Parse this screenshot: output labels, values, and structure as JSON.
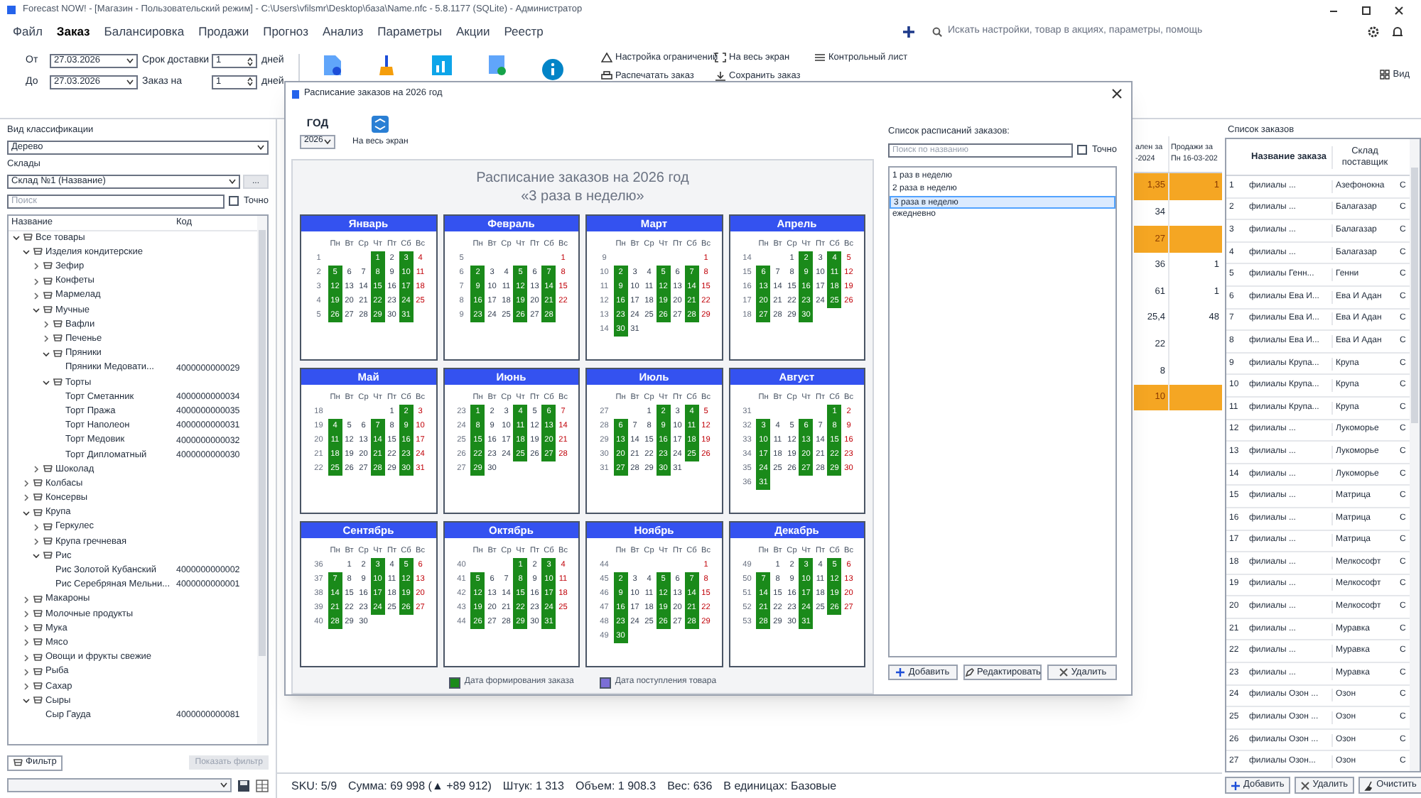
{
  "window": {
    "title": "Forecast NOW! - [Магазин - Пользовательский режим] - C:\\Users\\vfilsmr\\Desktop\\база\\Name.nfc - 5.8.1177 (SQLite) - Администратор"
  },
  "menu": [
    {
      "label": "Файл",
      "selected": false
    },
    {
      "label": "Заказ",
      "selected": true
    },
    {
      "label": "Балансировка",
      "selected": false
    },
    {
      "label": "Продажи",
      "selected": false
    },
    {
      "label": "Прогноз",
      "selected": false
    },
    {
      "label": "Анализ",
      "selected": false
    },
    {
      "label": "Параметры",
      "selected": false
    },
    {
      "label": "Акции",
      "selected": false
    },
    {
      "label": "Реестр",
      "selected": false
    }
  ],
  "search": {
    "placeholder": "Искать настройки, товар в акциях, параметры, помощь"
  },
  "toolbar": {
    "from_label": "От",
    "from": "27.03.2026",
    "to_label": "До",
    "to": "27.03.2026",
    "delivery_label": "Срок доставки",
    "delivery": "1",
    "delivery_unit": "дней",
    "order_label": "Заказ на",
    "order": "1",
    "order_unit": "дней",
    "small_buttons": [
      {
        "label": "Настройка ограничений",
        "kind": "warning"
      },
      {
        "label": "На весь экран",
        "kind": "expand"
      },
      {
        "label": "Контрольный лист",
        "kind": "list"
      },
      {
        "label": "Распечатать заказ",
        "kind": "print"
      },
      {
        "label": "Сохранить заказ",
        "kind": "save"
      }
    ],
    "view_button": "Вид"
  },
  "left": {
    "classification_label": "Вид классификации",
    "classification": "Дерево",
    "warehouse_label": "Склады",
    "warehouse": "Склад №1 (Название)",
    "more_button": "...",
    "search_placeholder": "Поиск",
    "exact": {
      "label": "Точно",
      "checked": false
    },
    "columns": [
      "Название",
      "Код"
    ],
    "tree": [
      {
        "label": "Все товары",
        "expanded": true,
        "children": [
          {
            "label": "Изделия кондитерские",
            "expanded": true,
            "children": [
              {
                "label": "Зефир",
                "expanded": false
              },
              {
                "label": "Конфеты",
                "expanded": false
              },
              {
                "label": "Мармелад",
                "expanded": false
              },
              {
                "label": "Мучные",
                "expanded": true,
                "children": [
                  {
                    "label": "Вафли",
                    "expanded": false
                  },
                  {
                    "label": "Печенье",
                    "expanded": false
                  },
                  {
                    "label": "Пряники",
                    "expanded": true,
                    "children": [
                      {
                        "label": "Пряники Медовати...",
                        "code": "4000000000029"
                      }
                    ]
                  },
                  {
                    "label": "Торты",
                    "expanded": true,
                    "children": [
                      {
                        "label": "Торт Сметанник",
                        "code": "4000000000034"
                      },
                      {
                        "label": "Торт Пража",
                        "code": "4000000000035"
                      },
                      {
                        "label": "Торт Наполеон",
                        "code": "4000000000031"
                      },
                      {
                        "label": "Торт Медовик",
                        "code": "4000000000032"
                      },
                      {
                        "label": "Торт Дипломатный",
                        "code": "4000000000030"
                      }
                    ]
                  }
                ]
              },
              {
                "label": "Шоколад",
                "expanded": false
              }
            ]
          },
          {
            "label": "Колбасы",
            "expanded": false
          },
          {
            "label": "Консервы",
            "expanded": false
          },
          {
            "label": "Крупа",
            "expanded": true,
            "children": [
              {
                "label": "Геркулес",
                "expanded": false
              },
              {
                "label": "Крупа гречневая",
                "expanded": false
              },
              {
                "label": "Рис",
                "expanded": true,
                "children": [
                  {
                    "label": "Рис Золотой Кубанский",
                    "code": "4000000000002"
                  },
                  {
                    "label": "Рис Серебряная Мельни...",
                    "code": "4000000000001"
                  }
                ]
              }
            ]
          },
          {
            "label": "Макароны",
            "expanded": false
          },
          {
            "label": "Молочные продукты",
            "expanded": false
          },
          {
            "label": "Мука",
            "expanded": false
          },
          {
            "label": "Мясо",
            "expanded": false
          },
          {
            "label": "Овощи и фрукты свежие",
            "expanded": false
          },
          {
            "label": "Рыба",
            "expanded": false
          },
          {
            "label": "Сахар",
            "expanded": false
          },
          {
            "label": "Сыры",
            "expanded": true,
            "children": [
              {
                "label": "Сыр Гауда",
                "code": "4000000000081"
              }
            ]
          }
        ]
      }
    ],
    "filter_button": "Фильтр",
    "show_filter_button": "Показать фильтр"
  },
  "center": {
    "columns": [
      "ален за\n-2024",
      "Продажи за\nПн 16-03-202"
    ],
    "rows": [
      {
        "highlighted": true,
        "column_1": "1,35",
        "column_2": "1"
      },
      {
        "highlighted": false,
        "column_1": "34"
      },
      {
        "highlighted": true,
        "column_1": "27"
      },
      {
        "highlighted": false,
        "column_1": "36",
        "column_2": "1"
      },
      {
        "highlighted": false,
        "column_1": "61",
        "column_2": "1"
      },
      {
        "highlighted": false,
        "column_1": "25,4",
        "column_2": "48"
      },
      {
        "highlighted": false,
        "column_1": "22"
      },
      {
        "highlighted": false,
        "column_1": "8"
      },
      {
        "highlighted": true,
        "column_1": "10"
      }
    ]
  },
  "status_bar": [
    "SKU: 5/9",
    "Сумма: 69 998 (▲ +89 912)",
    "Штук: 1 313",
    "Объем: 1 908.3",
    "Вес: 636",
    "В единицах: Базовые"
  ],
  "modal": {
    "title": "Расписание заказов на 2026 год",
    "year_label": "ГОД",
    "year": "2026",
    "fullscreen_button": "На весь экран",
    "heading": "Расписание заказов на 2026 год",
    "subheading": "«3 раза в неделю»",
    "order_days": [
      true,
      false,
      false,
      true,
      false,
      true,
      false
    ],
    "months": [
      {
        "name": "Январь",
        "weekdays": [
          "Пн",
          "Вт",
          "Ср",
          "Чт",
          "Пт",
          "Сб",
          "Вс"
        ],
        "weeks": [
          {
            "week": "1",
            "days": [
              "1",
              "2",
              "3",
              "4"
            ]
          },
          {
            "week": "2",
            "days": [
              "5",
              "6",
              "7",
              "8",
              "9",
              "10",
              "11"
            ]
          },
          {
            "week": "3",
            "days": [
              "12",
              "13",
              "14",
              "15",
              "16",
              "17",
              "18"
            ]
          },
          {
            "week": "4",
            "days": [
              "19",
              "20",
              "21",
              "22",
              "23",
              "24",
              "25"
            ]
          },
          {
            "week": "5",
            "days": [
              "26",
              "27",
              "28",
              "29",
              "30",
              "31"
            ]
          }
        ]
      },
      {
        "name": "Февраль",
        "weekdays": [
          "Пн",
          "Вт",
          "Ср",
          "Чт",
          "Пт",
          "Сб",
          "Вс"
        ],
        "weeks": [
          {
            "week": "5",
            "days": [
              "1"
            ]
          },
          {
            "week": "6",
            "days": [
              "2",
              "3",
              "4",
              "5",
              "6",
              "7",
              "8"
            ]
          },
          {
            "week": "7",
            "days": [
              "9",
              "10",
              "11",
              "12",
              "13",
              "14",
              "15"
            ]
          },
          {
            "week": "8",
            "days": [
              "16",
              "17",
              "18",
              "19",
              "20",
              "21",
              "22"
            ]
          },
          {
            "week": "9",
            "days": [
              "23",
              "24",
              "25",
              "26",
              "27",
              "28"
            ]
          }
        ]
      },
      {
        "name": "Март",
        "weekdays": [
          "Пн",
          "Вт",
          "Ср",
          "Чт",
          "Пт",
          "Сб",
          "Вс"
        ],
        "weeks": [
          {
            "week": "9",
            "days": [
              "1"
            ]
          },
          {
            "week": "10",
            "days": [
              "2",
              "3",
              "4",
              "5",
              "6",
              "7",
              "8"
            ]
          },
          {
            "week": "11",
            "days": [
              "9",
              "10",
              "11",
              "12",
              "13",
              "14",
              "15"
            ]
          },
          {
            "week": "12",
            "days": [
              "16",
              "17",
              "18",
              "19",
              "20",
              "21",
              "22"
            ]
          },
          {
            "week": "13",
            "days": [
              "23",
              "24",
              "25",
              "26",
              "27",
              "28",
              "29"
            ]
          },
          {
            "week": "14",
            "days": [
              "30",
              "31"
            ]
          }
        ]
      },
      {
        "name": "Апрель",
        "weekdays": [
          "Пн",
          "Вт",
          "Ср",
          "Чт",
          "Пт",
          "Сб",
          "Вс"
        ],
        "weeks": [
          {
            "week": "14",
            "days": [
              "1",
              "2",
              "3",
              "4",
              "5"
            ]
          },
          {
            "week": "15",
            "days": [
              "6",
              "7",
              "8",
              "9",
              "10",
              "11",
              "12"
            ]
          },
          {
            "week": "16",
            "days": [
              "13",
              "14",
              "15",
              "16",
              "17",
              "18",
              "19"
            ]
          },
          {
            "week": "17",
            "days": [
              "20",
              "21",
              "22",
              "23",
              "24",
              "25",
              "26"
            ]
          },
          {
            "week": "18",
            "days": [
              "27",
              "28",
              "29",
              "30"
            ]
          }
        ]
      },
      {
        "name": "Май",
        "weekdays": [
          "Пн",
          "Вт",
          "Ср",
          "Чт",
          "Пт",
          "Сб",
          "Вс"
        ],
        "weeks": [
          {
            "week": "18",
            "days": [
              "1",
              "2",
              "3"
            ]
          },
          {
            "week": "19",
            "days": [
              "4",
              "5",
              "6",
              "7",
              "8",
              "9",
              "10"
            ]
          },
          {
            "week": "20",
            "days": [
              "11",
              "12",
              "13",
              "14",
              "15",
              "16",
              "17"
            ]
          },
          {
            "week": "21",
            "days": [
              "18",
              "19",
              "20",
              "21",
              "22",
              "23",
              "24"
            ]
          },
          {
            "week": "22",
            "days": [
              "25",
              "26",
              "27",
              "28",
              "29",
              "30",
              "31"
            ]
          }
        ]
      },
      {
        "name": "Июнь",
        "weekdays": [
          "Пн",
          "Вт",
          "Ср",
          "Чт",
          "Пт",
          "Сб",
          "Вс"
        ],
        "weeks": [
          {
            "week": "23",
            "days": [
              "1",
              "2",
              "3",
              "4",
              "5",
              "6",
              "7"
            ]
          },
          {
            "week": "24",
            "days": [
              "8",
              "9",
              "10",
              "11",
              "12",
              "13",
              "14"
            ]
          },
          {
            "week": "25",
            "days": [
              "15",
              "16",
              "17",
              "18",
              "19",
              "20",
              "21"
            ]
          },
          {
            "week": "26",
            "days": [
              "22",
              "23",
              "24",
              "25",
              "26",
              "27",
              "28"
            ]
          },
          {
            "week": "27",
            "days": [
              "29",
              "30"
            ]
          }
        ]
      },
      {
        "name": "Июль",
        "weekdays": [
          "Пн",
          "Вт",
          "Ср",
          "Чт",
          "Пт",
          "Сб",
          "Вс"
        ],
        "weeks": [
          {
            "week": "27",
            "days": [
              "1",
              "2",
              "3",
              "4",
              "5"
            ]
          },
          {
            "week": "28",
            "days": [
              "6",
              "7",
              "8",
              "9",
              "10",
              "11",
              "12"
            ]
          },
          {
            "week": "29",
            "days": [
              "13",
              "14",
              "15",
              "16",
              "17",
              "18",
              "19"
            ]
          },
          {
            "week": "30",
            "days": [
              "20",
              "21",
              "22",
              "23",
              "24",
              "25",
              "26"
            ]
          },
          {
            "week": "31",
            "days": [
              "27",
              "28",
              "29",
              "30",
              "31"
            ]
          }
        ]
      },
      {
        "name": "Август",
        "weekdays": [
          "Пн",
          "Вт",
          "Ср",
          "Чт",
          "Пт",
          "Сб",
          "Вс"
        ],
        "weeks": [
          {
            "week": "31",
            "days": [
              "1",
              "2"
            ]
          },
          {
            "week": "32",
            "days": [
              "3",
              "4",
              "5",
              "6",
              "7",
              "8",
              "9"
            ]
          },
          {
            "week": "33",
            "days": [
              "10",
              "11",
              "12",
              "13",
              "14",
              "15",
              "16"
            ]
          },
          {
            "week": "34",
            "days": [
              "17",
              "18",
              "19",
              "20",
              "21",
              "22",
              "23"
            ]
          },
          {
            "week": "35",
            "days": [
              "24",
              "25",
              "26",
              "27",
              "28",
              "29",
              "30"
            ]
          },
          {
            "week": "36",
            "days": [
              "31"
            ]
          }
        ]
      },
      {
        "name": "Сентябрь",
        "weekdays": [
          "Пн",
          "Вт",
          "Ср",
          "Чт",
          "Пт",
          "Сб",
          "Вс"
        ],
        "weeks": [
          {
            "week": "36",
            "days": [
              "1",
              "2",
              "3",
              "4",
              "5",
              "6"
            ]
          },
          {
            "week": "37",
            "days": [
              "7",
              "8",
              "9",
              "10",
              "11",
              "12",
              "13"
            ]
          },
          {
            "week": "38",
            "days": [
              "14",
              "15",
              "16",
              "17",
              "18",
              "19",
              "20"
            ]
          },
          {
            "week": "39",
            "days": [
              "21",
              "22",
              "23",
              "24",
              "25",
              "26",
              "27"
            ]
          },
          {
            "week": "40",
            "days": [
              "28",
              "29",
              "30"
            ]
          }
        ]
      },
      {
        "name": "Октябрь",
        "weekdays": [
          "Пн",
          "Вт",
          "Ср",
          "Чт",
          "Пт",
          "Сб",
          "Вс"
        ],
        "weeks": [
          {
            "week": "40",
            "days": [
              "1",
              "2",
              "3",
              "4"
            ]
          },
          {
            "week": "41",
            "days": [
              "5",
              "6",
              "7",
              "8",
              "9",
              "10",
              "11"
            ]
          },
          {
            "week": "42",
            "days": [
              "12",
              "13",
              "14",
              "15",
              "16",
              "17",
              "18"
            ]
          },
          {
            "week": "43",
            "days": [
              "19",
              "20",
              "21",
              "22",
              "23",
              "24",
              "25"
            ]
          },
          {
            "week": "44",
            "days": [
              "26",
              "27",
              "28",
              "29",
              "30",
              "31"
            ]
          }
        ]
      },
      {
        "name": "Ноябрь",
        "weekdays": [
          "Пн",
          "Вт",
          "Ср",
          "Чт",
          "Пт",
          "Сб",
          "Вс"
        ],
        "weeks": [
          {
            "week": "44",
            "days": [
              "1"
            ]
          },
          {
            "week": "45",
            "days": [
              "2",
              "3",
              "4",
              "5",
              "6",
              "7",
              "8"
            ]
          },
          {
            "week": "46",
            "days": [
              "9",
              "10",
              "11",
              "12",
              "13",
              "14",
              "15"
            ]
          },
          {
            "week": "47",
            "days": [
              "16",
              "17",
              "18",
              "19",
              "20",
              "21",
              "22"
            ]
          },
          {
            "week": "48",
            "days": [
              "23",
              "24",
              "25",
              "26",
              "27",
              "28",
              "29"
            ]
          },
          {
            "week": "49",
            "days": [
              "30"
            ]
          }
        ]
      },
      {
        "name": "Декабрь",
        "weekdays": [
          "Пн",
          "Вт",
          "Ср",
          "Чт",
          "Пт",
          "Сб",
          "Вс"
        ],
        "weeks": [
          {
            "week": "49",
            "days": [
              "1",
              "2",
              "3",
              "4",
              "5",
              "6"
            ]
          },
          {
            "week": "50",
            "days": [
              "7",
              "8",
              "9",
              "10",
              "11",
              "12",
              "13"
            ]
          },
          {
            "week": "51",
            "days": [
              "14",
              "15",
              "16",
              "17",
              "18",
              "19",
              "20"
            ]
          },
          {
            "week": "52",
            "days": [
              "21",
              "22",
              "23",
              "24",
              "25",
              "26",
              "27"
            ]
          },
          {
            "week": "53",
            "days": [
              "28",
              "29",
              "30",
              "31"
            ]
          }
        ]
      }
    ],
    "legend": [
      {
        "label": "Дата формирования заказа",
        "color": "#1a8a1a"
      },
      {
        "label": "Дата поступления товара",
        "color": "#7b6fd6"
      }
    ],
    "list_label": "Список расписаний заказов:",
    "list_search_placeholder": "Поиск по названию",
    "list_exact": {
      "label": "Точно",
      "checked": false
    },
    "schedules": [
      {
        "label": "1 раз в неделю",
        "selected": false
      },
      {
        "label": "2 раза в неделю",
        "selected": false
      },
      {
        "label": "3 раза в неделю",
        "selected": true
      },
      {
        "label": "ежедневно",
        "selected": false
      }
    ],
    "buttons": [
      {
        "label": "Добавить",
        "kind": "add"
      },
      {
        "label": "Редактировать",
        "kind": "edit"
      },
      {
        "label": "Удалить",
        "kind": "delete"
      }
    ]
  },
  "orders": {
    "title": "Список заказов",
    "columns": [
      "Название заказа",
      "Склад поставщик"
    ],
    "rows": [
      {
        "number": "1",
        "cells": [
          "филиалы ...",
          "Азефонокна",
          "С"
        ]
      },
      {
        "number": "2",
        "cells": [
          "филиалы ...",
          "Балагазар",
          "С"
        ]
      },
      {
        "number": "3",
        "cells": [
          "филиалы ...",
          "Балагазар",
          "С"
        ]
      },
      {
        "number": "4",
        "cells": [
          "филиалы ...",
          "Балагазар",
          "С"
        ]
      },
      {
        "number": "5",
        "cells": [
          "филиалы Генн...",
          "Генни",
          "С"
        ]
      },
      {
        "number": "6",
        "cells": [
          "филиалы Ева И...",
          "Ева И Адан",
          "С"
        ]
      },
      {
        "number": "7",
        "cells": [
          "филиалы Ева И...",
          "Ева И Адан",
          "С"
        ]
      },
      {
        "number": "8",
        "cells": [
          "филиалы Ева И...",
          "Ева И Адан",
          "С"
        ]
      },
      {
        "number": "9",
        "cells": [
          "филиалы Крупа...",
          "Крупа",
          "С"
        ]
      },
      {
        "number": "10",
        "cells": [
          "филиалы Крупа...",
          "Крупа",
          "С"
        ]
      },
      {
        "number": "11",
        "cells": [
          "филиалы Крупа...",
          "Крупа",
          "С"
        ]
      },
      {
        "number": "12",
        "cells": [
          "филиалы ...",
          "Лукоморье",
          "С"
        ]
      },
      {
        "number": "13",
        "cells": [
          "филиалы ...",
          "Лукоморье",
          "С"
        ]
      },
      {
        "number": "14",
        "cells": [
          "филиалы ...",
          "Лукоморье",
          "С"
        ]
      },
      {
        "number": "15",
        "cells": [
          "филиалы ...",
          "Матрица",
          "С"
        ]
      },
      {
        "number": "16",
        "cells": [
          "филиалы ...",
          "Матрица",
          "С"
        ]
      },
      {
        "number": "17",
        "cells": [
          "филиалы ...",
          "Матрица",
          "С"
        ]
      },
      {
        "number": "18",
        "cells": [
          "филиалы ...",
          "Мелкософт",
          "С"
        ]
      },
      {
        "number": "19",
        "cells": [
          "филиалы ...",
          "Мелкософт",
          "С"
        ]
      },
      {
        "number": "20",
        "cells": [
          "филиалы ...",
          "Мелкософт",
          "С"
        ]
      },
      {
        "number": "21",
        "cells": [
          "филиалы ...",
          "Муравка",
          "С"
        ]
      },
      {
        "number": "22",
        "cells": [
          "филиалы ...",
          "Муравка",
          "С"
        ]
      },
      {
        "number": "23",
        "cells": [
          "филиалы ...",
          "Муравка",
          "С"
        ]
      },
      {
        "number": "24",
        "cells": [
          "филиалы Озон ...",
          "Озон",
          "С"
        ]
      },
      {
        "number": "25",
        "cells": [
          "филиалы Озон ...",
          "Озон",
          "С"
        ]
      },
      {
        "number": "26",
        "cells": [
          "филиалы Озон ...",
          "Озон",
          "С"
        ]
      },
      {
        "number": "27",
        "cells": [
          "филиалы Озон...",
          "Озон",
          "С"
        ]
      }
    ],
    "buttons": [
      {
        "label": "Добавить",
        "kind": "add"
      },
      {
        "label": "Удалить",
        "kind": "delete"
      },
      {
        "label": "Очистить",
        "kind": "clear"
      }
    ]
  }
}
